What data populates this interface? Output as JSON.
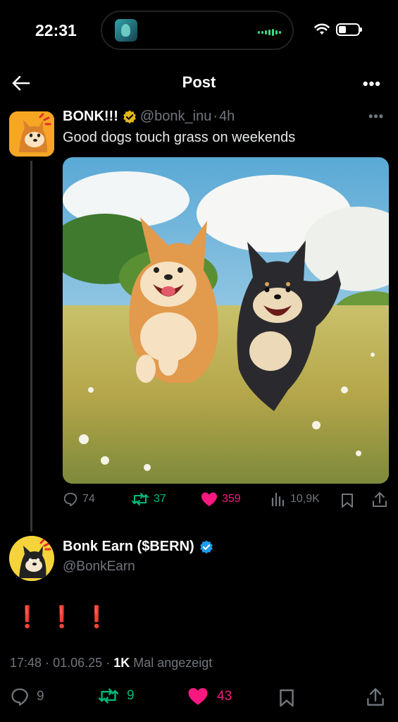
{
  "status_bar": {
    "time": "22:31"
  },
  "header": {
    "title": "Post"
  },
  "post": {
    "author_name": "BONK!!!",
    "author_handle": "@bonk_inu",
    "separator": "·",
    "age": "4h",
    "text": "Good dogs touch grass on weekends",
    "stats": {
      "replies": "74",
      "reposts": "37",
      "likes": "359",
      "views": "10,9K"
    }
  },
  "reply": {
    "author_name": "Bonk Earn ($BERN)",
    "author_handle": "@BonkEarn",
    "text": "❗❗❗",
    "time": "17:48",
    "date": "01.06.25",
    "views_count": "1K",
    "views_label": "Mal angezeigt",
    "separator": "·",
    "stats": {
      "replies": "9",
      "reposts": "9",
      "likes": "43"
    }
  },
  "colors": {
    "background": "#000000",
    "muted": "#71767b",
    "repost": "#00ba7c",
    "like": "#f91880",
    "verified_gold": "#e2b719",
    "verified_blue": "#1d9bf0"
  }
}
